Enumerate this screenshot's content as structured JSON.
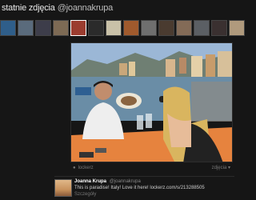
{
  "header": {
    "title": "statnie zdjęcia",
    "handle": "@joannakrupa"
  },
  "thumbnails": [
    {
      "color": "#2f5e8a"
    },
    {
      "color": "#5a6b7c"
    },
    {
      "color": "#3d3d4a"
    },
    {
      "color": "#7d6a54"
    },
    {
      "color": "#9b3c2f",
      "selected": true
    },
    {
      "color": "#2b2b2b"
    },
    {
      "color": "#c9c1a8"
    },
    {
      "color": "#a05a2d"
    },
    {
      "color": "#6f6f6f"
    },
    {
      "color": "#4a3b30"
    },
    {
      "color": "#836b57"
    },
    {
      "color": "#5b5f64"
    },
    {
      "color": "#3a3030"
    },
    {
      "color": "#b09a7d"
    }
  ],
  "photo_footer": {
    "source": "lockerz",
    "size": "zdjęcia ▾"
  },
  "tweet": {
    "author": "Joanna Krupa",
    "handle": "@joannakrupa",
    "text": "This is paradise! Italy! Love it here! lockerz.com/s/213288505",
    "time": "Szczegóły"
  }
}
